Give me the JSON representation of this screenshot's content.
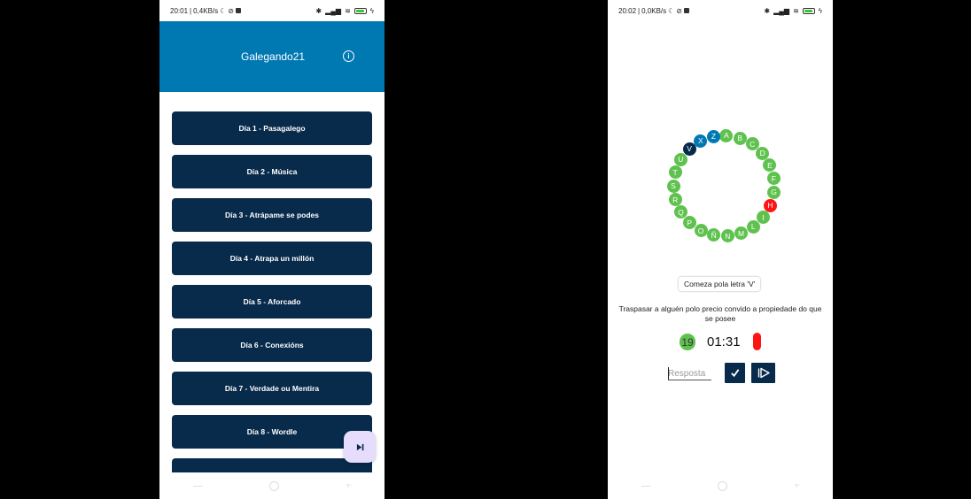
{
  "left": {
    "status": {
      "time": "20:01",
      "speed": "0,4KB/s"
    },
    "appbar": {
      "title": "Galegando21",
      "info_icon": "info-icon"
    },
    "days": [
      "Día 1 - Pasagalego",
      "Día 2 - Música",
      "Día 3 - Atrápame se podes",
      "Día 4 - Atrapa un millón",
      "Día 5 - Aforcado",
      "Día 6 - Conexións",
      "Día 7 - Verdade ou Mentira",
      "Día 8 - Wordle",
      ""
    ],
    "fab_icon": "skip-next-icon"
  },
  "right": {
    "status": {
      "time": "20:02",
      "speed": "0,0KB/s"
    },
    "ring": [
      {
        "letter": "A",
        "state": "correct"
      },
      {
        "letter": "B",
        "state": "correct"
      },
      {
        "letter": "C",
        "state": "correct"
      },
      {
        "letter": "D",
        "state": "correct"
      },
      {
        "letter": "E",
        "state": "correct"
      },
      {
        "letter": "F",
        "state": "correct"
      },
      {
        "letter": "G",
        "state": "correct"
      },
      {
        "letter": "H",
        "state": "wrong"
      },
      {
        "letter": "I",
        "state": "correct"
      },
      {
        "letter": "L",
        "state": "correct"
      },
      {
        "letter": "M",
        "state": "correct"
      },
      {
        "letter": "N",
        "state": "correct"
      },
      {
        "letter": "Ñ",
        "state": "correct"
      },
      {
        "letter": "O",
        "state": "correct"
      },
      {
        "letter": "P",
        "state": "correct"
      },
      {
        "letter": "Q",
        "state": "correct"
      },
      {
        "letter": "R",
        "state": "correct"
      },
      {
        "letter": "S",
        "state": "correct"
      },
      {
        "letter": "T",
        "state": "correct"
      },
      {
        "letter": "U",
        "state": "correct"
      },
      {
        "letter": "V",
        "state": "current"
      },
      {
        "letter": "X",
        "state": "pending"
      },
      {
        "letter": "Z",
        "state": "pending"
      }
    ],
    "colors": {
      "correct": "#5fc24f",
      "wrong": "#ff1414",
      "current": "#082a4b",
      "pending": "#0079b3",
      "primary": "#082a4b",
      "appbar": "#0079b3"
    },
    "hint": "Comeza pola letra 'V'",
    "definition": "Traspasar a alguén polo precio convido a propiedade do que se posee",
    "score": "19",
    "timer": "01:31",
    "answer_placeholder": "Resposta",
    "check_icon": "check-icon",
    "pass_icon": "skip-icon"
  }
}
